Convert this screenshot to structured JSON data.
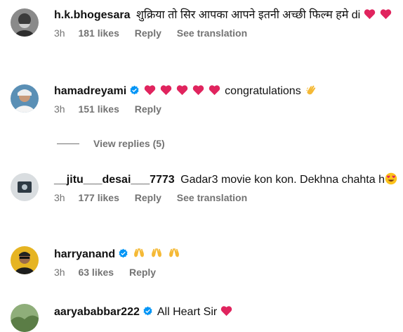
{
  "comments": [
    {
      "username": "h.k.bhogesara",
      "text": "शुक्रिया तो सिर आपका आपने इतनी अच्छी फिल्म हमे di",
      "time": "3h",
      "likes": "181 likes",
      "reply": "Reply",
      "translate": "See translation"
    },
    {
      "username": "hamadreyami",
      "text": "congratulations",
      "time": "3h",
      "likes": "151 likes",
      "reply": "Reply"
    },
    {
      "username": "__jitu___desai___7773",
      "text": "Gadar3 movie kon kon. Dekhna chahta h",
      "time": "3h",
      "likes": "177 likes",
      "reply": "Reply",
      "translate": "See translation"
    },
    {
      "username": "harryanand",
      "time": "3h",
      "likes": "63 likes",
      "reply": "Reply"
    },
    {
      "username": "aaryababbar222",
      "text": "All Heart Sir"
    }
  ],
  "view_replies": "View replies (5)",
  "colors": {
    "heart": "#e0245e",
    "verified": "#0095f6",
    "meta": "#737373"
  }
}
